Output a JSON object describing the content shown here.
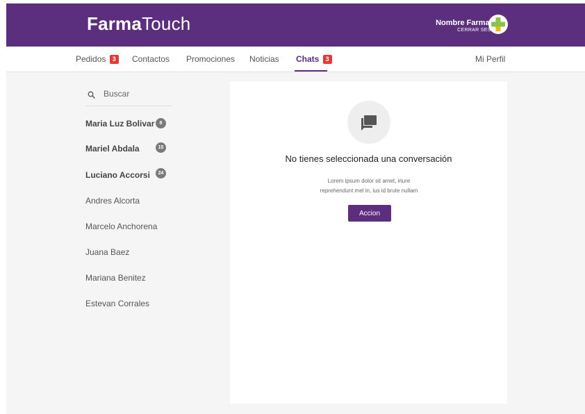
{
  "header": {
    "logo_bold": "Farma",
    "logo_light": "Touch",
    "pharmacy_name": "Nombre Farmacia",
    "logout_label": "CERRAR SESIÓN"
  },
  "nav": {
    "pedidos": {
      "label": "Pedidos",
      "badge": "3"
    },
    "contactos": "Contactos",
    "promociones": "Promociones",
    "noticias": "Noticias",
    "chats": {
      "label": "Chats",
      "badge": "3"
    },
    "profile": "Mi Perfil"
  },
  "sidebar": {
    "search_placeholder": "Buscar",
    "contacts": [
      {
        "name": "Maria Luz Bolivar",
        "unread": "8"
      },
      {
        "name": "Mariel Abdala",
        "unread": "15"
      },
      {
        "name": "Luciano Accorsi",
        "unread": "24"
      },
      {
        "name": "Andres Alcorta"
      },
      {
        "name": "Marcelo Anchorena"
      },
      {
        "name": "Juana Baez"
      },
      {
        "name": "Mariana Benitez"
      },
      {
        "name": "Estevan Corrales"
      }
    ]
  },
  "main": {
    "empty_title": "No tienes seleccionada una conversación",
    "empty_body_line1": "Lorem ipsum dolor sit amet, iriure",
    "empty_body_line2": "reprehendunt mel in, ius id brute nullam",
    "action_label": "Accion"
  },
  "colors": {
    "brand_purple": "#5c2e7e",
    "badge_red": "#e53935",
    "logo_green": "#8bc34a"
  },
  "icons": [
    "search-icon",
    "chat-icon",
    "pharmacy-cross-icon"
  ]
}
